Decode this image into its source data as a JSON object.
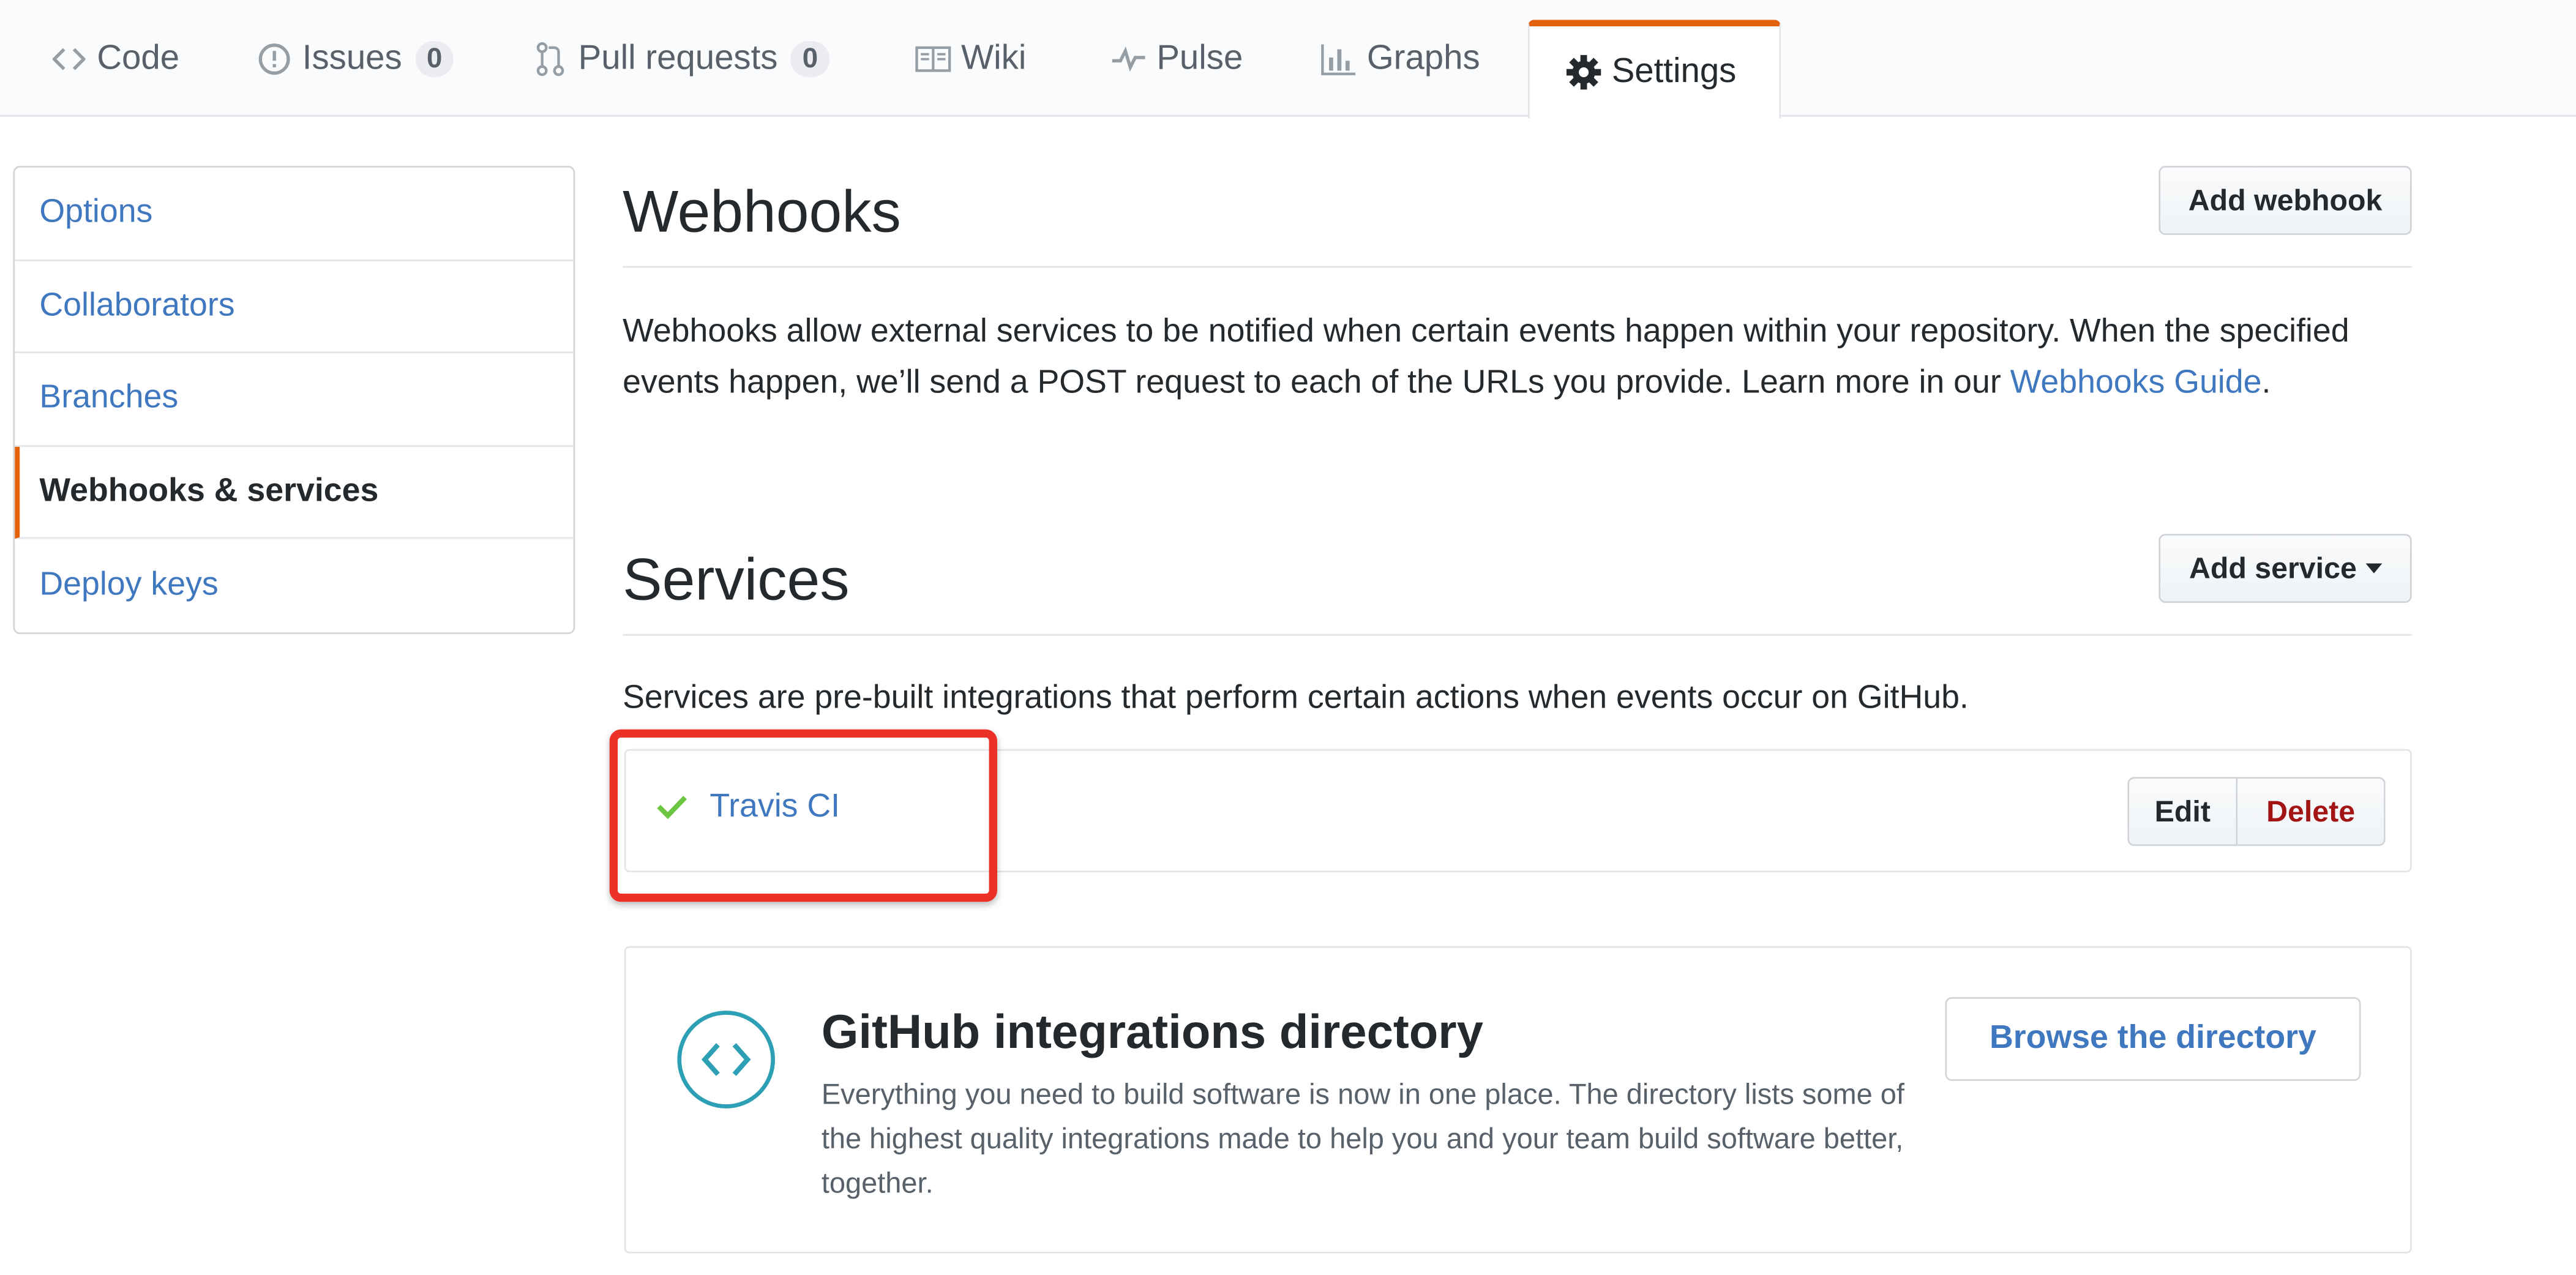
{
  "tabs": [
    {
      "label": "Code",
      "icon": "code-icon"
    },
    {
      "label": "Issues",
      "icon": "issue-icon",
      "count": "0"
    },
    {
      "label": "Pull requests",
      "icon": "pull-request-icon",
      "count": "0"
    },
    {
      "label": "Wiki",
      "icon": "book-icon"
    },
    {
      "label": "Pulse",
      "icon": "pulse-icon"
    },
    {
      "label": "Graphs",
      "icon": "graph-icon"
    },
    {
      "label": "Settings",
      "icon": "gear-icon",
      "selected": true
    }
  ],
  "sidebar": {
    "items": [
      {
        "label": "Options"
      },
      {
        "label": "Collaborators"
      },
      {
        "label": "Branches"
      },
      {
        "label": "Webhooks & services",
        "active": true
      },
      {
        "label": "Deploy keys"
      }
    ]
  },
  "webhooks": {
    "title": "Webhooks",
    "add_button": "Add webhook",
    "description": "Webhooks allow external services to be notified when certain events happen within your repository. When the specified events happen, we’ll send a POST request to each of the URLs you provide. Learn more in our ",
    "guide_link": "Webhooks Guide",
    "description_end": "."
  },
  "services": {
    "title": "Services",
    "add_button": "Add service",
    "description": "Services are pre-built integrations that perform certain actions when events occur on GitHub.",
    "items": [
      {
        "name": "Travis CI",
        "status_icon": "check-icon",
        "edit_label": "Edit",
        "delete_label": "Delete"
      }
    ]
  },
  "directory": {
    "title": "GitHub integrations directory",
    "description": "Everything you need to build software is now in one place. The directory lists some of the highest quality integrations made to help you and your team build software better, together.",
    "button": "Browse the directory",
    "icon": "code-icon"
  },
  "colors": {
    "link": "#4078c0",
    "active_accent": "#e36209",
    "highlight_border": "#ec3228",
    "check": "#6cc644",
    "delete": "#a31515",
    "directory_icon": "#2ea0b5"
  }
}
